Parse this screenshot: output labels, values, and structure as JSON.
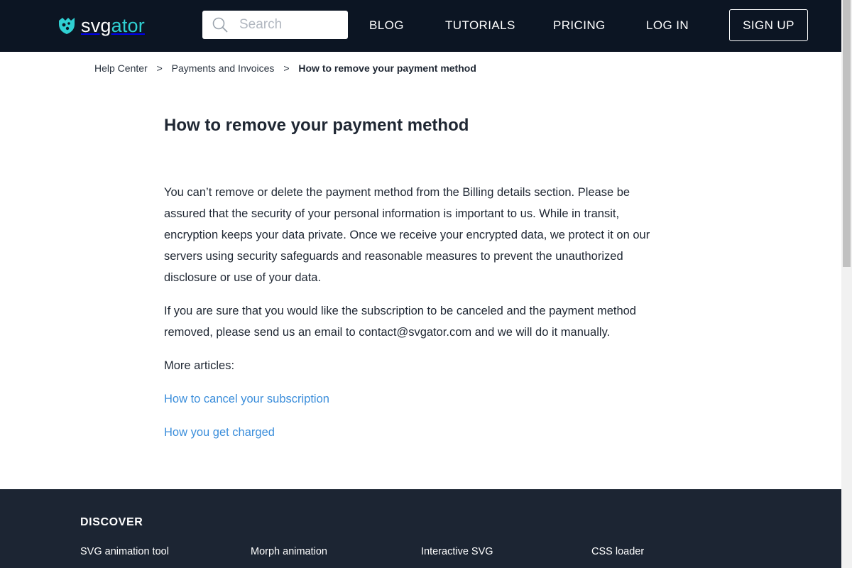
{
  "header": {
    "logo": {
      "text_main": "svg",
      "text_accent": "ator"
    },
    "search": {
      "placeholder": "Search",
      "value": ""
    },
    "nav": [
      {
        "label": "BLOG"
      },
      {
        "label": "TUTORIALS"
      },
      {
        "label": "PRICING"
      },
      {
        "label": "LOG IN"
      }
    ],
    "signup_label": "SIGN UP"
  },
  "breadcrumb": {
    "items": [
      "Help Center",
      "Payments and Invoices"
    ],
    "separator": ">",
    "current": "How to remove your payment method"
  },
  "article": {
    "title": "How to remove your payment method",
    "paragraph1": "You can’t remove or delete the payment method from the Billing details section. Please be assured that the security of your personal information is important to us. While in transit, encryption keeps your data private. Once we receive your encrypted data, we protect it on our servers using security safeguards and reasonable measures to prevent the unauthorized disclosure or use of your data.",
    "paragraph2": "If you are sure that you would like the subscription to be canceled and the payment method removed, please send us an email to contact@svgator.com and we will do it manually.",
    "more_label": "More articles:",
    "related": [
      {
        "label": "How to cancel your subscription"
      },
      {
        "label": "How you get charged"
      }
    ]
  },
  "footer": {
    "heading": "DISCOVER",
    "links": [
      {
        "label": "SVG animation tool"
      },
      {
        "label": "Morph animation"
      },
      {
        "label": "Interactive SVG"
      },
      {
        "label": "CSS loader"
      }
    ]
  },
  "colors": {
    "header_bg": "#0c1523",
    "footer_bg": "#1c2533",
    "accent": "#2fd0d2",
    "link": "#3b8edb"
  }
}
